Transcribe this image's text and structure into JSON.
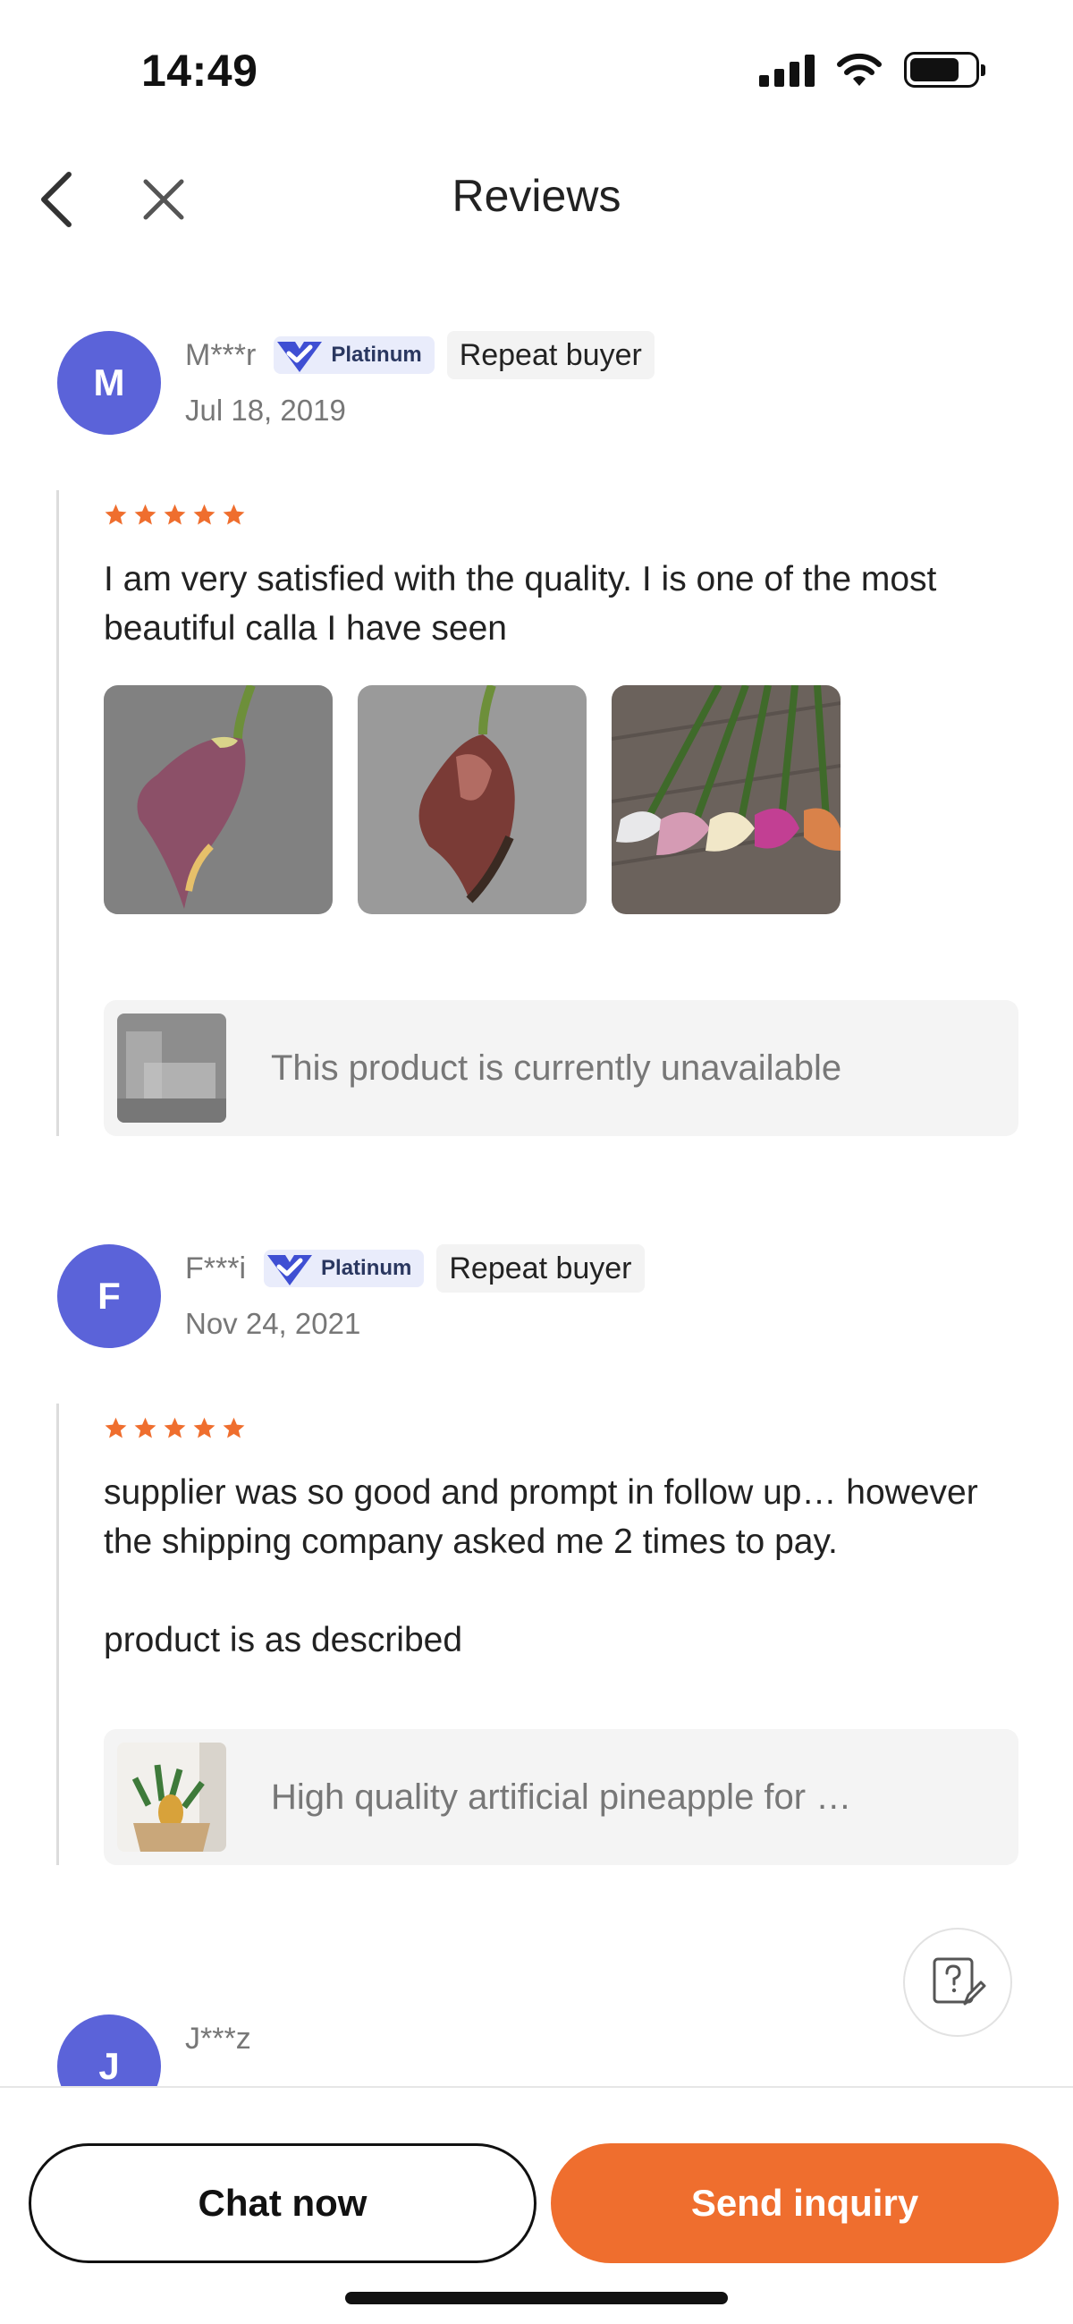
{
  "status_bar": {
    "time": "14:49"
  },
  "header": {
    "title": "Reviews"
  },
  "reviews": [
    {
      "avatar_letter": "M",
      "name": "M***r",
      "badge": "Platinum",
      "repeat_label": "Repeat buyer",
      "date": "Jul 18, 2019",
      "rating": 5,
      "text": "I am very satisfied with the quality. I is one of the most beautiful calla I have seen",
      "photo_count": 3,
      "product_name": "This product is currently unavailable"
    },
    {
      "avatar_letter": "F",
      "name": "F***i",
      "badge": "Platinum",
      "repeat_label": "Repeat buyer",
      "date": "Nov 24, 2021",
      "rating": 5,
      "text": "supplier was so good and prompt in follow up… however the shipping company asked me 2 times to pay.\n\nproduct is as described",
      "product_name": "High quality artificial pineapple for …"
    },
    {
      "avatar_letter": "J",
      "name": "J***z"
    }
  ],
  "bottom_bar": {
    "chat_label": "Chat now",
    "inquiry_label": "Send inquiry"
  },
  "colors": {
    "accent": "#ef6e2e",
    "avatar": "#5b63d9",
    "star": "#ef6e2e",
    "platinum_badge_bg": "#e9ecfb"
  },
  "icons": [
    "signal-icon",
    "wifi-icon",
    "battery-icon",
    "back-arrow-icon",
    "close-icon",
    "verified-check-icon",
    "star-icon",
    "help-edit-icon"
  ]
}
